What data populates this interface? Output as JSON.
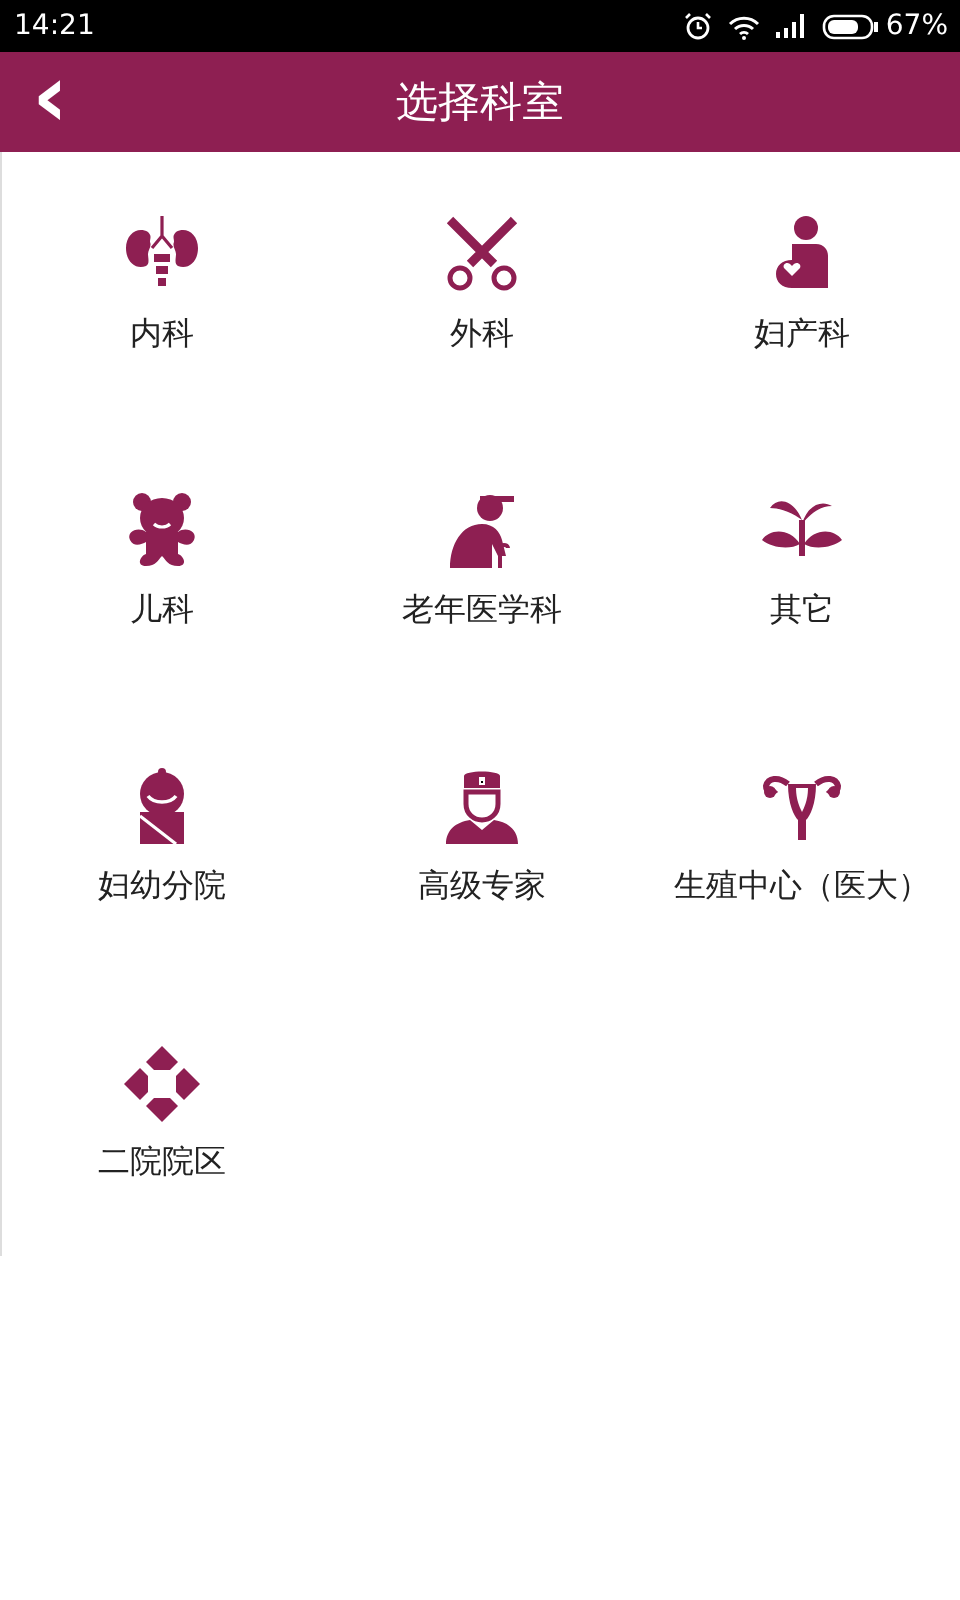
{
  "status_bar": {
    "time": "14:21",
    "battery_percent": "67%"
  },
  "header": {
    "back_icon": "‹",
    "title": "选择科室"
  },
  "departments": [
    {
      "label": "内科",
      "kind": "kidneys"
    },
    {
      "label": "外科",
      "kind": "scissors"
    },
    {
      "label": "妇产科",
      "kind": "pregnant"
    },
    {
      "label": "儿科",
      "kind": "bear"
    },
    {
      "label": "老年医学科",
      "kind": "elder"
    },
    {
      "label": "其它",
      "kind": "sprout"
    },
    {
      "label": "妇幼分院",
      "kind": "baby"
    },
    {
      "label": "高级专家",
      "kind": "doctor"
    },
    {
      "label": "生殖中心（医大）",
      "kind": "uterus"
    },
    {
      "label": "二院院区",
      "kind": "cross"
    }
  ]
}
